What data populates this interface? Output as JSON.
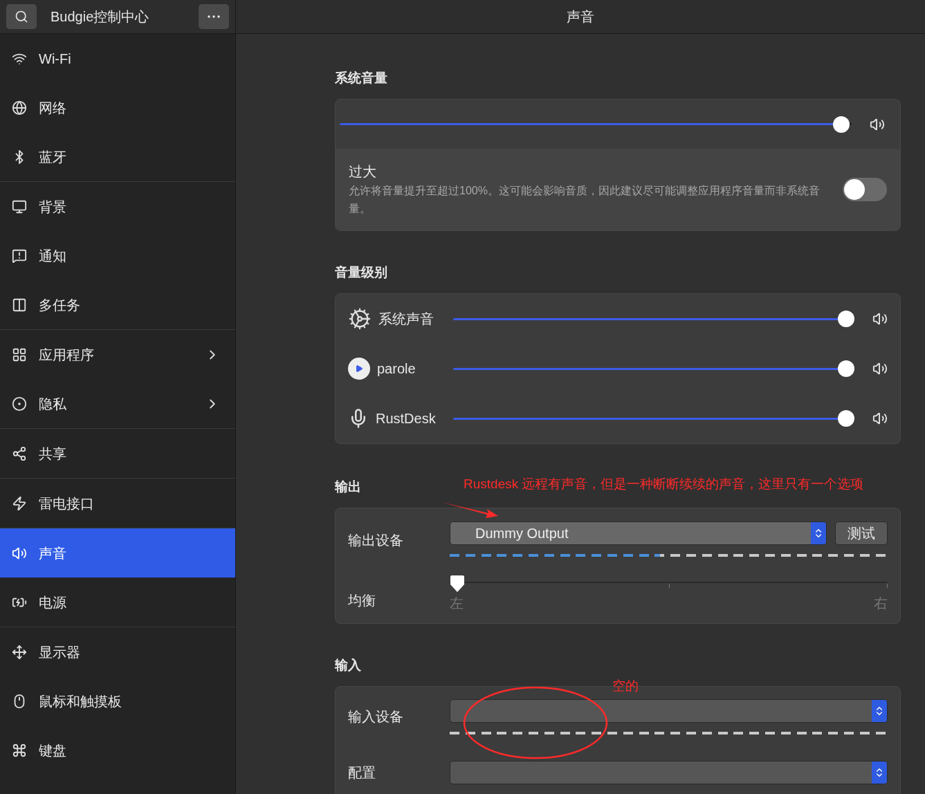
{
  "header": {
    "app_title": "Budgie控制中心",
    "page_title": "声音"
  },
  "sidebar": {
    "groups": [
      [
        {
          "label": "Wi-Fi",
          "selected": false,
          "chevron": false
        },
        {
          "label": "网络",
          "selected": false,
          "chevron": false
        },
        {
          "label": "蓝牙",
          "selected": false,
          "chevron": false
        }
      ],
      [
        {
          "label": "背景",
          "selected": false,
          "chevron": false
        },
        {
          "label": "通知",
          "selected": false,
          "chevron": false
        },
        {
          "label": "多任务",
          "selected": false,
          "chevron": false
        }
      ],
      [
        {
          "label": "应用程序",
          "selected": false,
          "chevron": true
        },
        {
          "label": "隐私",
          "selected": false,
          "chevron": true
        }
      ],
      [
        {
          "label": "共享",
          "selected": false,
          "chevron": false
        }
      ],
      [
        {
          "label": "雷电接口",
          "selected": false,
          "chevron": false
        }
      ],
      [
        {
          "label": "声音",
          "selected": true,
          "chevron": false
        },
        {
          "label": "电源",
          "selected": false,
          "chevron": false
        }
      ],
      [
        {
          "label": "显示器",
          "selected": false,
          "chevron": false
        },
        {
          "label": "鼠标和触摸板",
          "selected": false,
          "chevron": false
        },
        {
          "label": "键盘",
          "selected": false,
          "chevron": false
        }
      ]
    ]
  },
  "system_volume": {
    "title": "系统音量",
    "level": 0.98,
    "overamplify": {
      "label": "过大",
      "description": "允许将音量提升至超过100%。这可能会影响音质，因此建议尽可能调整应用程序音量而非系统音量。",
      "on": false
    }
  },
  "volume_levels": {
    "title": "音量级别",
    "apps": [
      {
        "name": "系统声音",
        "level": 0.98
      },
      {
        "name": "parole",
        "level": 0.98
      },
      {
        "name": "RustDesk",
        "level": 0.98
      }
    ]
  },
  "output": {
    "title": "输出",
    "device_label": "输出设备",
    "device": "Dummy Output",
    "test_button": "测试",
    "meter": {
      "level": 0.48
    },
    "balance": {
      "label": "均衡",
      "level": 0,
      "left": "左",
      "right": "右"
    }
  },
  "input": {
    "title": "输入",
    "device_label": "输入设备",
    "profile_label": "配置"
  },
  "annotations": [
    {
      "kind": "text",
      "text": "Rustdesk 远程有声音，但是一种断断续续的声音，这里只有一个选项"
    },
    {
      "kind": "arrow"
    },
    {
      "kind": "ellipse"
    },
    {
      "kind": "text",
      "text": "空的"
    }
  ]
}
